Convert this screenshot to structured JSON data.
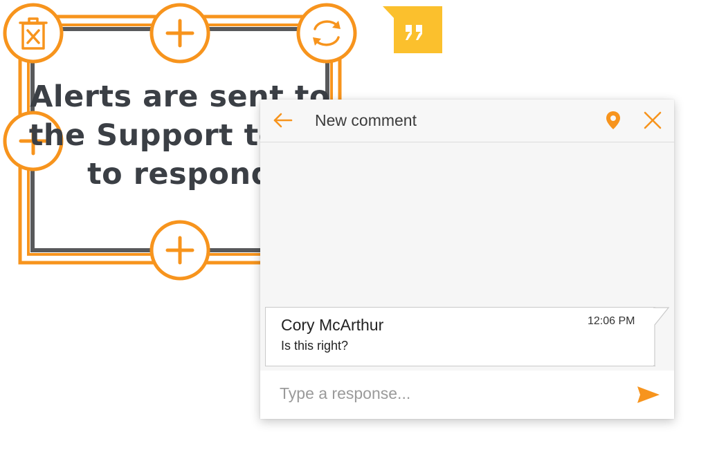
{
  "canvas": {
    "text_lines": [
      "Alerts are sent to",
      "the Support team",
      "to respond"
    ]
  },
  "comment_panel": {
    "title": "New comment",
    "icons": [
      "back-arrow-icon",
      "location-pin-icon",
      "close-icon"
    ],
    "message": {
      "author": "Cory McArthur",
      "time": "12:06 PM",
      "text": "Is this right?"
    },
    "response_placeholder": "Type a response...",
    "send_icon": "send-icon"
  },
  "toolbar_icons": [
    "delete-icon",
    "add-icon",
    "rotate-icon",
    "add-icon",
    "add-icon"
  ],
  "badge_icon": "quote-icon",
  "colors": {
    "accent": "#F7941D",
    "badge": "#FBC02D",
    "frame_dark": "#58595B",
    "text_dark": "#3B3F45"
  }
}
